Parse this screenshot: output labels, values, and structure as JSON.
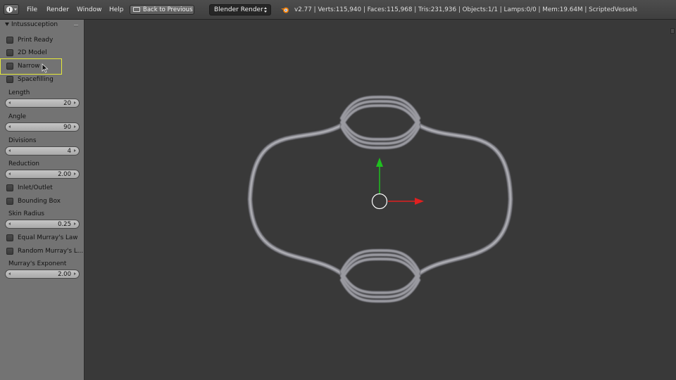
{
  "header": {
    "editor_menu_icon": "info-icon",
    "menus": [
      "File",
      "Render",
      "Window",
      "Help"
    ],
    "back_button": "Back to Previous",
    "render_engine": "Blender Render",
    "stats": "v2.77 | Verts:115,940 | Faces:115,968 | Tris:231,936 | Objects:1/1 | Lamps:0/0 | Mem:19.64M | ScriptedVessels"
  },
  "panel": {
    "title": "Intussuception",
    "checkboxes": [
      {
        "label": "Print Ready",
        "checked": false
      },
      {
        "label": "2D Model",
        "checked": false
      },
      {
        "label": "Narrow",
        "checked": false
      },
      {
        "label": "Spacefilling",
        "checked": false
      }
    ],
    "length": {
      "label": "Length",
      "value": "20"
    },
    "angle": {
      "label": "Angle",
      "value": "90"
    },
    "divisions": {
      "label": "Divisions",
      "value": "4"
    },
    "reduction": {
      "label": "Reduction",
      "value": "2.00"
    },
    "inlet_outlet": {
      "label": "Inlet/Outlet",
      "checked": false
    },
    "bounding_box": {
      "label": "Bounding Box",
      "checked": false
    },
    "skin_radius": {
      "label": "Skin Radius",
      "value": "0.25"
    },
    "equal_murray": {
      "label": "Equal Murray's Law",
      "checked": false
    },
    "random_murray": {
      "label": "Random Murray's L...",
      "checked": false
    },
    "murray_exponent": {
      "label": "Murray's Exponent",
      "value": "2.00"
    }
  },
  "colors": {
    "highlight": "#e6ea3a",
    "y_axis": "#1fc01f",
    "x_axis": "#e02020",
    "vessel": "#8e8e94"
  }
}
